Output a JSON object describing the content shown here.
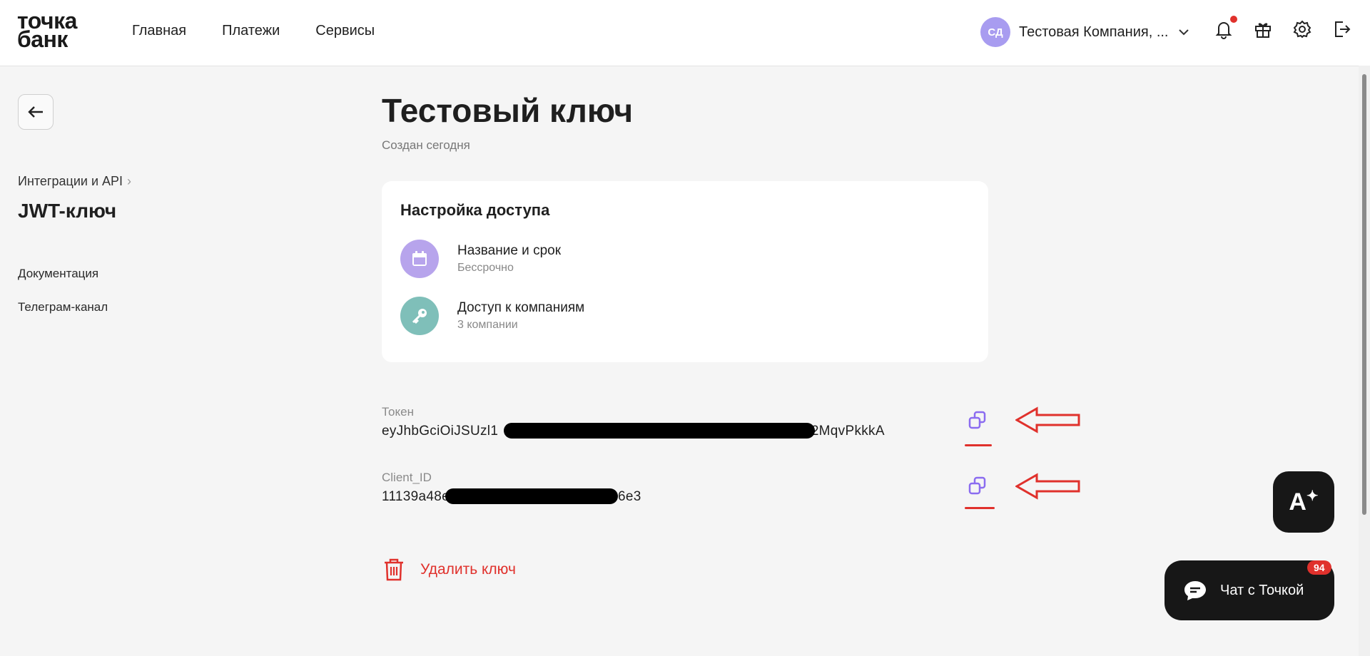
{
  "header": {
    "logo_line1": "точка",
    "logo_line2": "банк",
    "nav": [
      "Главная",
      "Платежи",
      "Сервисы"
    ],
    "avatar_initials": "СД",
    "company_name": "Тестовая Компания, ..."
  },
  "sidebar": {
    "breadcrumb": "Интеграции и API",
    "title": "JWT-ключ",
    "links": [
      "Документация",
      "Телеграм-канал"
    ]
  },
  "main": {
    "title": "Тестовый ключ",
    "subtitle": "Создан сегодня",
    "card": {
      "title": "Настройка доступа",
      "rows": [
        {
          "title": "Название и срок",
          "subtitle": "Бессрочно",
          "icon": "calendar-icon",
          "color": "#b7a4ec"
        },
        {
          "title": "Доступ к компаниям",
          "subtitle": "3 компании",
          "icon": "key-icon",
          "color": "#7fbfb9"
        }
      ]
    },
    "token": {
      "label": "Токен",
      "value_start": "eyJhbGciOiJSUzl1",
      "value_end": "r2MqvPkkkA"
    },
    "client_id": {
      "label": "Client_ID",
      "value_start": "11139a48e",
      "value_end": "6e3"
    },
    "delete_label": "Удалить ключ"
  },
  "widgets": {
    "ai_label": "A",
    "chat_label": "Чат с Точкой",
    "chat_badge": "94"
  },
  "colors": {
    "accent": "#8b6cf0",
    "danger": "#e0312c"
  }
}
